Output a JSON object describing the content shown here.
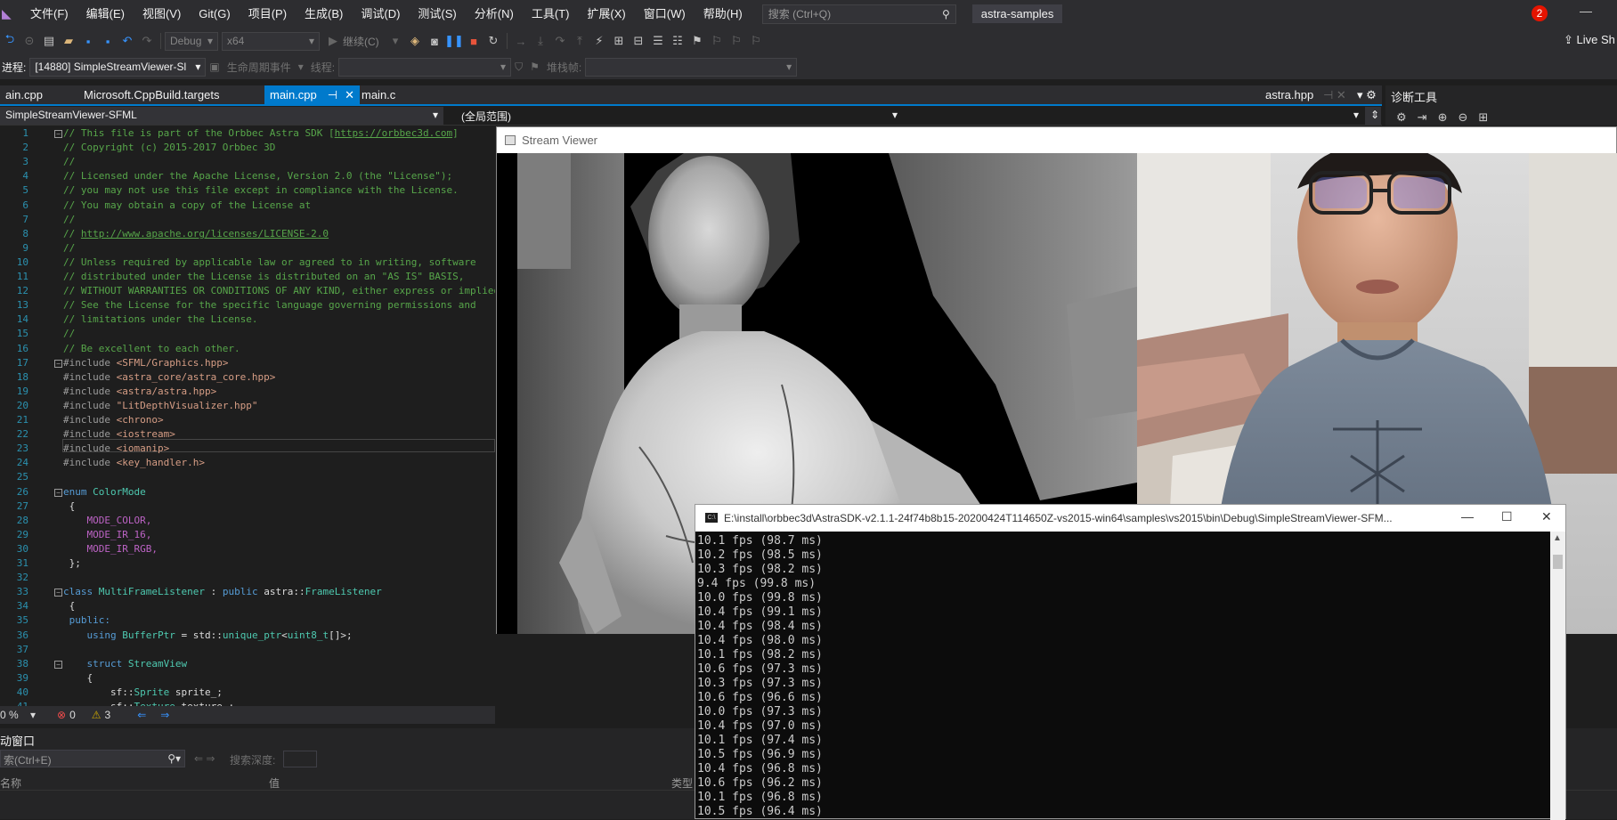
{
  "menubar": {
    "items": [
      "文件(F)",
      "编辑(E)",
      "视图(V)",
      "Git(G)",
      "项目(P)",
      "生成(B)",
      "调试(D)",
      "测试(S)",
      "分析(N)",
      "工具(T)",
      "扩展(X)",
      "窗口(W)",
      "帮助(H)"
    ],
    "search_placeholder": "搜索 (Ctrl+Q)",
    "solution": "astra-samples",
    "notifications": "2"
  },
  "toolbar": {
    "config": "Debug",
    "platform": "x64",
    "continue_label": "继续(C)",
    "live_share": "Live Sh"
  },
  "debugbar": {
    "process_label": "进程:",
    "process_value": "[14880] SimpleStreamViewer-Sl",
    "lifecycle_label": "生命周期事件",
    "thread_label": "线程:",
    "stackframe_label": "堆栈帧:"
  },
  "tabs": {
    "items": [
      "ain.cpp",
      "Microsoft.CppBuild.targets",
      "main.cpp",
      "main.c"
    ],
    "right": "astra.hpp"
  },
  "navbar": {
    "project": "SimpleStreamViewer-SFML",
    "scope": "(全局范围)"
  },
  "diagnostics": {
    "title": "诊断工具"
  },
  "editor": {
    "zoom": "0 %",
    "errors": "0",
    "warnings": "3"
  },
  "autos": {
    "header": "动窗口",
    "search_placeholder": "索(Ctrl+E)",
    "depth_label": "搜索深度:",
    "col_name": "名称",
    "col_value": "值",
    "col_type": "类型"
  },
  "stream_viewer": {
    "title": "Stream Viewer"
  },
  "console": {
    "title": "E:\\install\\orbbec3d\\AstraSDK-v2.1.1-24f74b8b15-20200424T114650Z-vs2015-win64\\samples\\vs2015\\bin\\Debug\\SimpleStreamViewer-SFM...",
    "lines": [
      "10.1 fps (98.7 ms)",
      "10.2 fps (98.5 ms)",
      "10.3 fps (98.2 ms)",
      "9.4 fps (99.8 ms)",
      "10.0 fps (99.8 ms)",
      "10.4 fps (99.1 ms)",
      "10.4 fps (98.4 ms)",
      "10.4 fps (98.0 ms)",
      "10.1 fps (98.2 ms)",
      "10.6 fps (97.3 ms)",
      "10.3 fps (97.3 ms)",
      "10.6 fps (96.6 ms)",
      "10.0 fps (97.3 ms)",
      "10.4 fps (97.0 ms)",
      "10.1 fps (97.4 ms)",
      "10.5 fps (96.9 ms)",
      "10.4 fps (96.8 ms)",
      "10.6 fps (96.2 ms)",
      "10.1 fps (96.8 ms)",
      "10.5 fps (96.4 ms)"
    ]
  },
  "code": [
    {
      "n": "1",
      "t": "// This file is part of the Orbbec Astra SDK [",
      "url": "https://orbbec3d.com",
      "tail": "]",
      "c": "cmt",
      "fold": true
    },
    {
      "n": "2",
      "t": "// Copyright (c) 2015-2017 Orbbec 3D",
      "c": "cmt"
    },
    {
      "n": "3",
      "t": "//",
      "c": "cmt"
    },
    {
      "n": "4",
      "t": "// Licensed under the Apache License, Version 2.0 (the \"License\");",
      "c": "cmt"
    },
    {
      "n": "5",
      "t": "// you may not use this file except in compliance with the License.",
      "c": "cmt"
    },
    {
      "n": "6",
      "t": "// You may obtain a copy of the License at",
      "c": "cmt"
    },
    {
      "n": "7",
      "t": "//",
      "c": "cmt"
    },
    {
      "n": "8",
      "t": "// ",
      "url": "http://www.apache.org/licenses/LICENSE-2.0",
      "c": "cmt"
    },
    {
      "n": "9",
      "t": "//",
      "c": "cmt"
    },
    {
      "n": "10",
      "t": "// Unless required by applicable law or agreed to in writing, software",
      "c": "cmt"
    },
    {
      "n": "11",
      "t": "// distributed under the License is distributed on an \"AS IS\" BASIS,",
      "c": "cmt"
    },
    {
      "n": "12",
      "t": "// WITHOUT WARRANTIES OR CONDITIONS OF ANY KIND, either express or implied.",
      "c": "cmt"
    },
    {
      "n": "13",
      "t": "// See the License for the specific language governing permissions and",
      "c": "cmt"
    },
    {
      "n": "14",
      "t": "// limitations under the License.",
      "c": "cmt"
    },
    {
      "n": "15",
      "t": "//",
      "c": "cmt"
    },
    {
      "n": "16",
      "t": "// Be excellent to each other.",
      "c": "cmt"
    },
    {
      "n": "17",
      "t": "#include <SFML/Graphics.hpp>",
      "c": "inc",
      "fold": true
    },
    {
      "n": "18",
      "t": "#include <astra_core/astra_core.hpp>",
      "c": "inc"
    },
    {
      "n": "19",
      "t": "#include <astra/astra.hpp>",
      "c": "inc"
    },
    {
      "n": "20",
      "t": "#include \"LitDepthVisualizer.hpp\"",
      "c": "inc"
    },
    {
      "n": "21",
      "t": "#include <chrono>",
      "c": "inc"
    },
    {
      "n": "22",
      "t": "#include <iostream>",
      "c": "inc"
    },
    {
      "n": "23",
      "t": "#include <iomanip>",
      "c": "inc"
    },
    {
      "n": "24",
      "t": "#include <key_handler.h>",
      "c": "inc"
    },
    {
      "n": "25",
      "t": "",
      "c": "id"
    },
    {
      "n": "26",
      "t": "enum ColorMode",
      "c": "enum",
      "fold": true
    },
    {
      "n": "27",
      "t": " {",
      "c": "id"
    },
    {
      "n": "28",
      "t": "    MODE_COLOR,",
      "c": "mac"
    },
    {
      "n": "29",
      "t": "    MODE_IR_16,",
      "c": "mac"
    },
    {
      "n": "30",
      "t": "    MODE_IR_RGB,",
      "c": "mac"
    },
    {
      "n": "31",
      "t": " };",
      "c": "id"
    },
    {
      "n": "32",
      "t": "",
      "c": "id"
    },
    {
      "n": "33",
      "t": "class MultiFrameListener : public astra::FrameListener",
      "c": "class",
      "fold": true
    },
    {
      "n": "34",
      "t": " {",
      "c": "id"
    },
    {
      "n": "35",
      "t": " public:",
      "c": "kw"
    },
    {
      "n": "36",
      "t": "    using BufferPtr = std::unique_ptr<uint8_t[]>;",
      "c": "using"
    },
    {
      "n": "37",
      "t": "",
      "c": "id"
    },
    {
      "n": "38",
      "t": "    struct StreamView",
      "c": "struct",
      "fold": true
    },
    {
      "n": "39",
      "t": "    {",
      "c": "id"
    },
    {
      "n": "40",
      "t": "        sf::Sprite sprite_;",
      "c": "member"
    },
    {
      "n": "41",
      "t": "        sf::Texture texture_;",
      "c": "member"
    }
  ]
}
